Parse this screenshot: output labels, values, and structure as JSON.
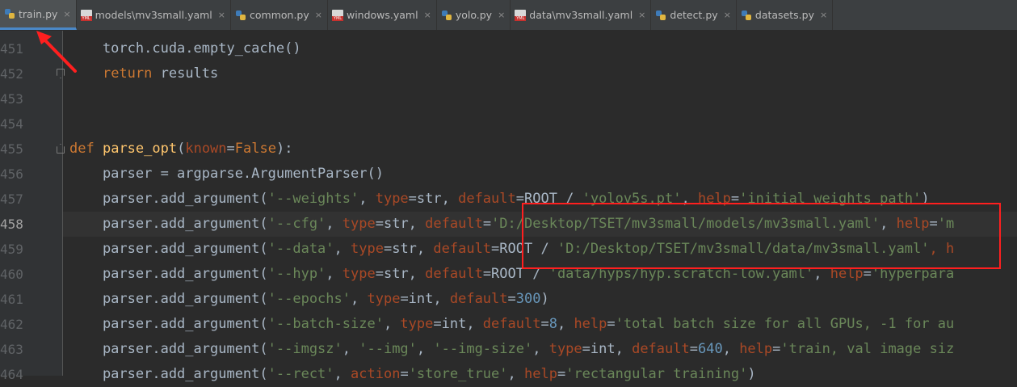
{
  "tabs": [
    {
      "label": "train.py",
      "icon": "python-file-icon",
      "type": "py",
      "active": true
    },
    {
      "label": "models\\mv3small.yaml",
      "icon": "yaml-file-icon",
      "type": "yml"
    },
    {
      "label": "common.py",
      "icon": "python-file-icon",
      "type": "py"
    },
    {
      "label": "windows.yaml",
      "icon": "yaml-file-icon",
      "type": "yml"
    },
    {
      "label": "yolo.py",
      "icon": "python-file-icon",
      "type": "py"
    },
    {
      "label": "data\\mv3small.yaml",
      "icon": "yaml-file-icon",
      "type": "yml"
    },
    {
      "label": "detect.py",
      "icon": "python-file-icon",
      "type": "py"
    },
    {
      "label": "datasets.py",
      "icon": "python-file-icon",
      "type": "py"
    }
  ],
  "close_glyph": "×",
  "lines": [
    {
      "num": "451"
    },
    {
      "num": "452"
    },
    {
      "num": "453"
    },
    {
      "num": "454"
    },
    {
      "num": "455"
    },
    {
      "num": "456"
    },
    {
      "num": "457"
    },
    {
      "num": "458",
      "current": true
    },
    {
      "num": "459"
    },
    {
      "num": "460"
    },
    {
      "num": "461"
    },
    {
      "num": "462"
    },
    {
      "num": "463"
    },
    {
      "num": "464"
    }
  ],
  "code": {
    "l451": "    torch.cuda.empty_cache()",
    "l452_kw": "return",
    "l452_rest": " results",
    "l455_def": "def",
    "l455_name": "parse_opt",
    "l455_open": "(",
    "l455_param": "known",
    "l455_eq": "=",
    "l455_false": "False",
    "l455_close": "):",
    "l456": "    parser = argparse.ArgumentParser()",
    "l457_a": "    parser.add_argument(",
    "l457_s1": "'--weights'",
    "l457_b": ", ",
    "l457_type": "type",
    "l457_c": "=str, ",
    "l457_default": "default",
    "l457_d": "=ROOT / ",
    "l457_s2": "'yolov5s.pt'",
    "l457_e": ", ",
    "l457_help": "help",
    "l457_f": "=",
    "l457_s3": "'initial weights path'",
    "l457_g": ")",
    "l458_a": "    parser.add_argument(",
    "l458_s1": "'--cfg'",
    "l458_b": ", ",
    "l458_type": "type",
    "l458_c": "=str, ",
    "l458_default": "default",
    "l458_d": "=",
    "l458_s2": "'D:/Desktop/TSET/mv3small/models/mv3small.yaml'",
    "l458_e": ", ",
    "l458_help": "help",
    "l458_f": "=",
    "l458_s3": "'m",
    "l459_a": "    parser.add_argument(",
    "l459_s1": "'--data'",
    "l459_b": ", ",
    "l459_type": "type",
    "l459_c": "=str, ",
    "l459_default": "default",
    "l459_d": "=ROOT / ",
    "l459_s2": "'D:/Desktop/TSET/mv3small/data/mv3small.yaml'",
    "l459_e": ", h",
    "l460_a": "    parser.add_argument(",
    "l460_s1": "'--hyp'",
    "l460_b": ", ",
    "l460_type": "type",
    "l460_c": "=str, ",
    "l460_default": "default",
    "l460_d": "=ROOT / ",
    "l460_s2": "'data/hyps/hyp.scratch-low.yaml'",
    "l460_e": ", ",
    "l460_help": "help",
    "l460_f": "=",
    "l460_s3": "'hyperpara",
    "l461_a": "    parser.add_argument(",
    "l461_s1": "'--epochs'",
    "l461_b": ", ",
    "l461_type": "type",
    "l461_c": "=int, ",
    "l461_default": "default",
    "l461_d": "=",
    "l461_n": "300",
    "l461_e": ")",
    "l462_a": "    parser.add_argument(",
    "l462_s1": "'--batch-size'",
    "l462_b": ", ",
    "l462_type": "type",
    "l462_c": "=int, ",
    "l462_default": "default",
    "l462_d": "=",
    "l462_n": "8",
    "l462_e": ", ",
    "l462_help": "help",
    "l462_f": "=",
    "l462_s2": "'total batch size for all GPUs, -1 for au",
    "l463_a": "    parser.add_argument(",
    "l463_s1": "'--imgsz'",
    "l463_b": ", ",
    "l463_s2": "'--img'",
    "l463_c": ", ",
    "l463_s3": "'--img-size'",
    "l463_d": ", ",
    "l463_type": "type",
    "l463_e": "=int, ",
    "l463_default": "default",
    "l463_f": "=",
    "l463_n": "640",
    "l463_g": ", ",
    "l463_help": "help",
    "l463_h": "=",
    "l463_s4": "'train, val image siz",
    "l464_a": "    parser.add_argument(",
    "l464_s1": "'--rect'",
    "l464_b": ", ",
    "l464_action": "action",
    "l464_c": "=",
    "l464_s2": "'store_true'",
    "l464_d": ", ",
    "l464_help": "help",
    "l464_e": "=",
    "l464_s3": "'rectangular training'",
    "l464_f": ")"
  },
  "colors": {
    "annotation_red": "#ff1f1f",
    "keyword": "#cc7832",
    "string": "#6a8759",
    "number": "#6897bb",
    "param": "#aa4926",
    "function": "#ffc66d",
    "text": "#a9b7c6"
  }
}
